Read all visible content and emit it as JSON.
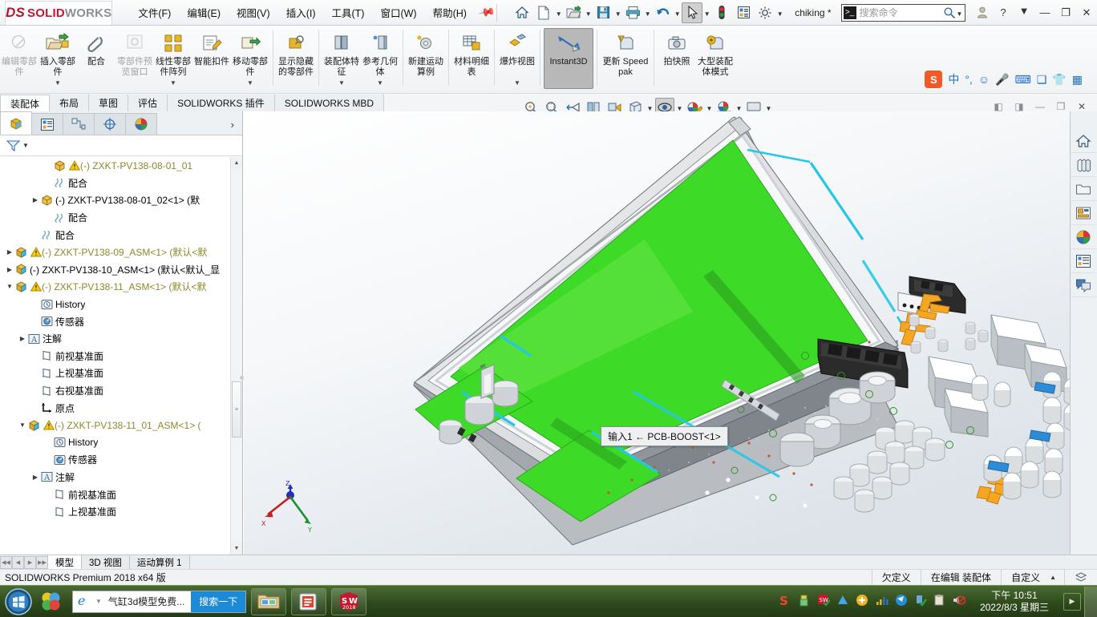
{
  "titlebar": {
    "logo_ds": "DS",
    "logo_solid": "SOLID",
    "logo_works": "WORKS",
    "menus": [
      {
        "label": "文件(F)",
        "name": "menu-file"
      },
      {
        "label": "编辑(E)",
        "name": "menu-edit"
      },
      {
        "label": "视图(V)",
        "name": "menu-view"
      },
      {
        "label": "插入(I)",
        "name": "menu-insert"
      },
      {
        "label": "工具(T)",
        "name": "menu-tools"
      },
      {
        "label": "窗口(W)",
        "name": "menu-window"
      },
      {
        "label": "帮助(H)",
        "name": "menu-help"
      }
    ],
    "quick_icons": [
      "home-icon",
      "new-document-icon",
      "open-folder-icon",
      "save-icon",
      "print-icon",
      "undo-icon",
      "select-cursor-icon",
      "traffic-light-icon",
      "options-list-icon",
      "gear-icon"
    ],
    "user": "chiking *",
    "search_placeholder": "搜索命令",
    "window_buttons": [
      "user-icon",
      "help-icon",
      "minimize-button",
      "restore-button",
      "close-button"
    ]
  },
  "ribbon": {
    "groups": [
      {
        "items": [
          {
            "label": "编辑零部件",
            "icon": "edit-component-icon",
            "disabled": true,
            "caret": false
          },
          {
            "label": "插入零部件",
            "icon": "insert-component-icon",
            "disabled": false,
            "caret": true
          },
          {
            "label": "配合",
            "icon": "mate-paperclip-icon",
            "disabled": false,
            "caret": false
          },
          {
            "label": "零部件预览窗口",
            "icon": "component-preview-icon",
            "disabled": true,
            "caret": false
          },
          {
            "label": "线性零部件阵列",
            "icon": "linear-pattern-icon",
            "disabled": false,
            "caret": true
          },
          {
            "label": "智能扣件",
            "icon": "smart-fastener-icon",
            "disabled": false,
            "caret": false
          },
          {
            "label": "移动零部件",
            "icon": "move-component-icon",
            "disabled": false,
            "caret": true
          }
        ]
      },
      {
        "items": [
          {
            "label": "显示隐藏的零部件",
            "icon": "show-hidden-components-icon",
            "disabled": false,
            "caret": false
          }
        ]
      },
      {
        "items": [
          {
            "label": "装配体特征",
            "icon": "assembly-feature-icon",
            "disabled": false,
            "caret": true
          },
          {
            "label": "参考几何体",
            "icon": "reference-geometry-icon",
            "disabled": false,
            "caret": true
          }
        ]
      },
      {
        "items": [
          {
            "label": "新建运动算例",
            "icon": "new-motion-study-icon",
            "disabled": false,
            "caret": false
          }
        ]
      },
      {
        "items": [
          {
            "label": "材料明细表",
            "icon": "bill-of-materials-icon",
            "disabled": false,
            "caret": false
          }
        ]
      },
      {
        "items": [
          {
            "label": "爆炸视图",
            "icon": "exploded-view-icon",
            "disabled": false,
            "caret": true
          }
        ]
      },
      {
        "items": [
          {
            "label": "Instant3D",
            "icon": "instant3d-icon",
            "disabled": false,
            "caret": false,
            "selected": true
          }
        ]
      },
      {
        "items": [
          {
            "label": "更新 Speedpak",
            "icon": "update-speedpak-icon",
            "disabled": false,
            "caret": false
          }
        ]
      },
      {
        "items": [
          {
            "label": "拍快照",
            "icon": "snapshot-camera-icon",
            "disabled": false,
            "caret": false
          },
          {
            "label": "大型装配体模式",
            "icon": "large-assembly-mode-icon",
            "disabled": false,
            "caret": false
          }
        ]
      }
    ]
  },
  "ime": {
    "brand": "S",
    "mode": "中",
    "items": [
      "punctuation-icon",
      "emoji-icon",
      "microphone-icon",
      "keyboard-icon",
      "screenshot-icon",
      "skin-icon",
      "toolbox-icon"
    ]
  },
  "command_tabs": [
    {
      "label": "装配体",
      "active": true
    },
    {
      "label": "布局",
      "active": false
    },
    {
      "label": "草图",
      "active": false
    },
    {
      "label": "评估",
      "active": false
    },
    {
      "label": "SOLIDWORKS 插件",
      "active": false
    },
    {
      "label": "SOLIDWORKS MBD",
      "active": false
    }
  ],
  "view_toolbar": [
    {
      "name": "zoom-to-fit-icon",
      "caret": false,
      "on": false
    },
    {
      "name": "zoom-to-area-icon",
      "caret": false,
      "on": false
    },
    {
      "name": "previous-view-icon",
      "caret": false,
      "on": false
    },
    {
      "name": "section-view-icon",
      "caret": false,
      "on": false
    },
    {
      "name": "view-orientation-icon",
      "caret": false,
      "on": false
    },
    {
      "name": "display-style-icon",
      "caret": true,
      "on": false
    },
    {
      "name": "hide-show-items-icon",
      "caret": true,
      "on": false
    },
    {
      "name": "edit-appearance-icon",
      "caret": true,
      "on": true
    },
    {
      "name": "apply-scene-icon",
      "caret": true,
      "on": false
    },
    {
      "name": "view-settings-icon",
      "caret": true,
      "on": false
    }
  ],
  "tree": {
    "tabs": [
      "feature-manager-tab",
      "property-manager-tab",
      "configuration-manager-tab",
      "dimxpert-manager-tab",
      "display-manager-tab"
    ],
    "filter_icon": "filter-funnel-icon",
    "items": [
      {
        "indent": 3,
        "twisty": "",
        "icon": "part-icon",
        "warn": true,
        "label": "(-) ZXKT-PV138-08-01_01",
        "olive": true
      },
      {
        "indent": 3,
        "twisty": "",
        "icon": "mates-icon",
        "warn": false,
        "label": "配合",
        "olive": false
      },
      {
        "indent": 2,
        "twisty": "collapsed",
        "icon": "part-icon",
        "warn": false,
        "label": "(-) ZXKT-PV138-08-01_02<1> (默",
        "olive": false
      },
      {
        "indent": 3,
        "twisty": "",
        "icon": "mates-icon",
        "warn": false,
        "label": "配合",
        "olive": false
      },
      {
        "indent": 2,
        "twisty": "",
        "icon": "mates-icon",
        "warn": false,
        "label": "配合",
        "olive": false
      },
      {
        "indent": 0,
        "twisty": "collapsed",
        "icon": "assembly-icon",
        "warn": true,
        "label": "(-) ZXKT-PV138-09_ASM<1> (默认<默",
        "olive": true
      },
      {
        "indent": 0,
        "twisty": "collapsed",
        "icon": "assembly-icon",
        "warn": false,
        "label": "(-) ZXKT-PV138-10_ASM<1> (默认<默认_显",
        "olive": false
      },
      {
        "indent": 0,
        "twisty": "expanded",
        "icon": "assembly-icon",
        "warn": true,
        "label": "(-) ZXKT-PV138-11_ASM<1> (默认<默",
        "olive": true
      },
      {
        "indent": 2,
        "twisty": "",
        "icon": "history-icon",
        "warn": false,
        "label": "History",
        "olive": false
      },
      {
        "indent": 2,
        "twisty": "",
        "icon": "sensor-icon",
        "warn": false,
        "label": "传感器",
        "olive": false
      },
      {
        "indent": 1,
        "twisty": "collapsed",
        "icon": "annotations-icon",
        "warn": false,
        "label": "注解",
        "olive": false
      },
      {
        "indent": 2,
        "twisty": "",
        "icon": "plane-icon",
        "warn": false,
        "label": "前视基准面",
        "olive": false
      },
      {
        "indent": 2,
        "twisty": "",
        "icon": "plane-icon",
        "warn": false,
        "label": "上视基准面",
        "olive": false
      },
      {
        "indent": 2,
        "twisty": "",
        "icon": "plane-icon",
        "warn": false,
        "label": "右视基准面",
        "olive": false
      },
      {
        "indent": 2,
        "twisty": "",
        "icon": "origin-icon",
        "warn": false,
        "label": "原点",
        "olive": false
      },
      {
        "indent": 1,
        "twisty": "expanded",
        "icon": "assembly-icon",
        "warn": true,
        "label": "(-) ZXKT-PV138-11_01_ASM<1> (",
        "olive": true
      },
      {
        "indent": 3,
        "twisty": "",
        "icon": "history-icon",
        "warn": false,
        "label": "History",
        "olive": false
      },
      {
        "indent": 3,
        "twisty": "",
        "icon": "sensor-icon",
        "warn": false,
        "label": "传感器",
        "olive": false
      },
      {
        "indent": 2,
        "twisty": "collapsed",
        "icon": "annotations-icon",
        "warn": false,
        "label": "注解",
        "olive": false
      },
      {
        "indent": 3,
        "twisty": "",
        "icon": "plane-icon",
        "warn": false,
        "label": "前视基准面",
        "olive": false
      },
      {
        "indent": 3,
        "twisty": "",
        "icon": "plane-icon",
        "warn": false,
        "label": "上视基准面",
        "olive": false
      }
    ]
  },
  "viewport": {
    "tooltip": "输入1 ← PCB-BOOST<1>",
    "triad_labels": {
      "x": "X",
      "y": "Y",
      "z": "Z"
    }
  },
  "task_pane": [
    "home-resources-icon",
    "design-library-icon",
    "file-explorer-icon",
    "view-palette-icon",
    "appearances-scenes-icon",
    "custom-properties-icon",
    "solidworks-forum-icon"
  ],
  "doc_window_buttons": [
    "restore-left-icon",
    "restore-right-icon",
    "minimize-doc-icon",
    "restore-doc-icon",
    "close-doc-icon"
  ],
  "bottom_tabs": [
    {
      "label": "模型",
      "active": true
    },
    {
      "label": "3D 视图",
      "active": false
    },
    {
      "label": "运动算例 1",
      "active": false
    }
  ],
  "status_bar": {
    "left": "SOLIDWORKS Premium 2018 x64 版",
    "items": [
      "欠定义",
      "在编辑 装配体",
      "自定义"
    ],
    "caret": "▲",
    "right_icon": "overlay-icon"
  },
  "taskbar": {
    "start": "start-orb-icon",
    "pinned_first": "media-center-icon",
    "ie_label": "气缸3d模型免费...",
    "ie_go": "搜索一下",
    "buttons": [
      "file-explorer-icon",
      "powerpoint-icon",
      "solidworks-2018-icon"
    ],
    "tray": [
      "sogou-icon",
      "usb-icon",
      "sw-tray-icon",
      "autodesk-icon",
      "update-icon",
      "network-monitor-icon",
      "blue-globe-icon",
      "shield-check-icon",
      "clipboard-icon",
      "volume-muted-icon"
    ],
    "clock_time": "下午 10:51",
    "clock_date": "2022/8/3 星期三"
  }
}
